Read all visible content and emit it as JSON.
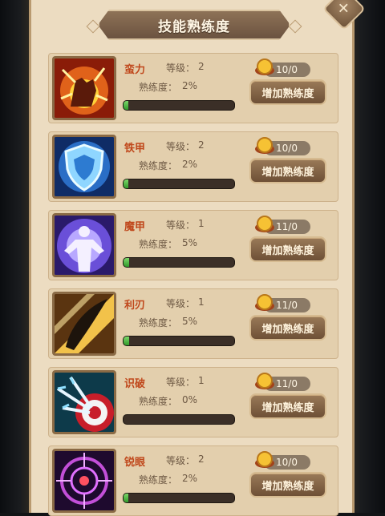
{
  "title": "技能熟练度",
  "level_label": "等级：",
  "proficiency_label": "熟练度：",
  "add_button_label": "增加熟练度",
  "skills": [
    {
      "name": "蛮力",
      "level": "2",
      "proficiency": "2%",
      "progress": 0.02,
      "cost": "10/0",
      "icon": "fist-icon"
    },
    {
      "name": "铁甲",
      "level": "2",
      "proficiency": "2%",
      "progress": 0.02,
      "cost": "10/0",
      "icon": "shield-icon"
    },
    {
      "name": "魔甲",
      "level": "1",
      "proficiency": "5%",
      "progress": 0.05,
      "cost": "11/0",
      "icon": "glowing-figure-icon"
    },
    {
      "name": "利刃",
      "level": "1",
      "proficiency": "5%",
      "progress": 0.05,
      "cost": "11/0",
      "icon": "blade-icon"
    },
    {
      "name": "识破",
      "level": "1",
      "proficiency": "0%",
      "progress": 0.0,
      "cost": "11/0",
      "icon": "arrows-target-icon"
    },
    {
      "name": "锐眼",
      "level": "2",
      "proficiency": "2%",
      "progress": 0.02,
      "cost": "10/0",
      "icon": "crosshair-icon"
    }
  ]
}
